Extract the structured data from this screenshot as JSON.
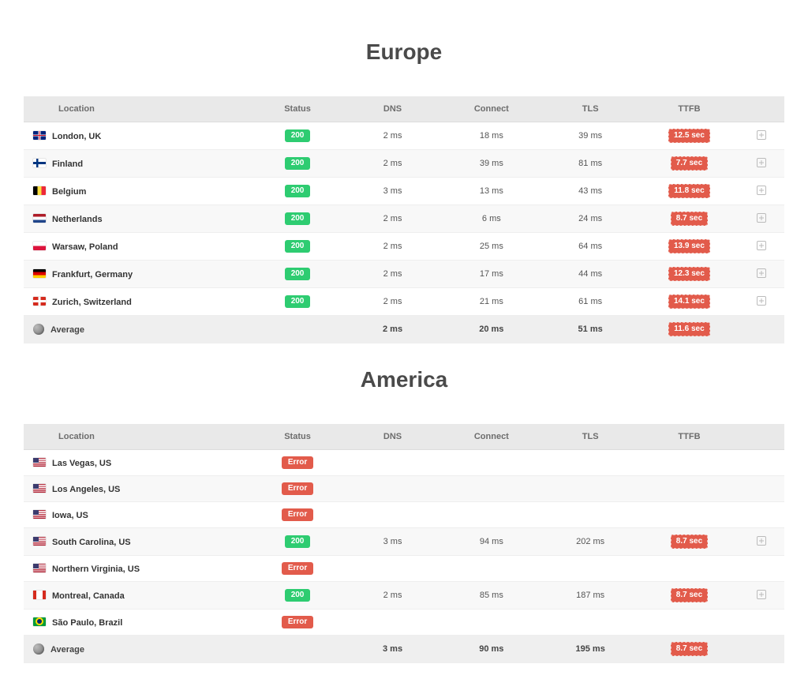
{
  "columns": {
    "location": "Location",
    "status": "Status",
    "dns": "DNS",
    "connect": "Connect",
    "tls": "TLS",
    "ttfb": "TTFB"
  },
  "status_labels": {
    "ok": "200",
    "error": "Error"
  },
  "average_label": "Average",
  "sections": [
    {
      "title": "Europe",
      "rows": [
        {
          "flag": "gb",
          "location": "London, UK",
          "status": "ok",
          "dns": "2 ms",
          "connect": "18 ms",
          "tls": "39 ms",
          "ttfb": "12.5 sec"
        },
        {
          "flag": "fi",
          "location": "Finland",
          "status": "ok",
          "dns": "2 ms",
          "connect": "39 ms",
          "tls": "81 ms",
          "ttfb": "7.7 sec"
        },
        {
          "flag": "be",
          "location": "Belgium",
          "status": "ok",
          "dns": "3 ms",
          "connect": "13 ms",
          "tls": "43 ms",
          "ttfb": "11.8 sec"
        },
        {
          "flag": "nl",
          "location": "Netherlands",
          "status": "ok",
          "dns": "2 ms",
          "connect": "6 ms",
          "tls": "24 ms",
          "ttfb": "8.7 sec"
        },
        {
          "flag": "pl",
          "location": "Warsaw, Poland",
          "status": "ok",
          "dns": "2 ms",
          "connect": "25 ms",
          "tls": "64 ms",
          "ttfb": "13.9 sec"
        },
        {
          "flag": "de",
          "location": "Frankfurt, Germany",
          "status": "ok",
          "dns": "2 ms",
          "connect": "17 ms",
          "tls": "44 ms",
          "ttfb": "12.3 sec"
        },
        {
          "flag": "ch",
          "location": "Zurich, Switzerland",
          "status": "ok",
          "dns": "2 ms",
          "connect": "21 ms",
          "tls": "61 ms",
          "ttfb": "14.1 sec"
        }
      ],
      "average": {
        "dns": "2 ms",
        "connect": "20 ms",
        "tls": "51 ms",
        "ttfb": "11.6 sec"
      }
    },
    {
      "title": "America",
      "rows": [
        {
          "flag": "us",
          "location": "Las Vegas, US",
          "status": "error"
        },
        {
          "flag": "us",
          "location": "Los Angeles, US",
          "status": "error"
        },
        {
          "flag": "us",
          "location": "Iowa, US",
          "status": "error"
        },
        {
          "flag": "us",
          "location": "South Carolina, US",
          "status": "ok",
          "dns": "3 ms",
          "connect": "94 ms",
          "tls": "202 ms",
          "ttfb": "8.7 sec"
        },
        {
          "flag": "us",
          "location": "Northern Virginia, US",
          "status": "error"
        },
        {
          "flag": "ca",
          "location": "Montreal, Canada",
          "status": "ok",
          "dns": "2 ms",
          "connect": "85 ms",
          "tls": "187 ms",
          "ttfb": "8.7 sec"
        },
        {
          "flag": "br",
          "location": "São Paulo, Brazil",
          "status": "error"
        }
      ],
      "average": {
        "dns": "3 ms",
        "connect": "90 ms",
        "tls": "195 ms",
        "ttfb": "8.7 sec"
      }
    }
  ]
}
